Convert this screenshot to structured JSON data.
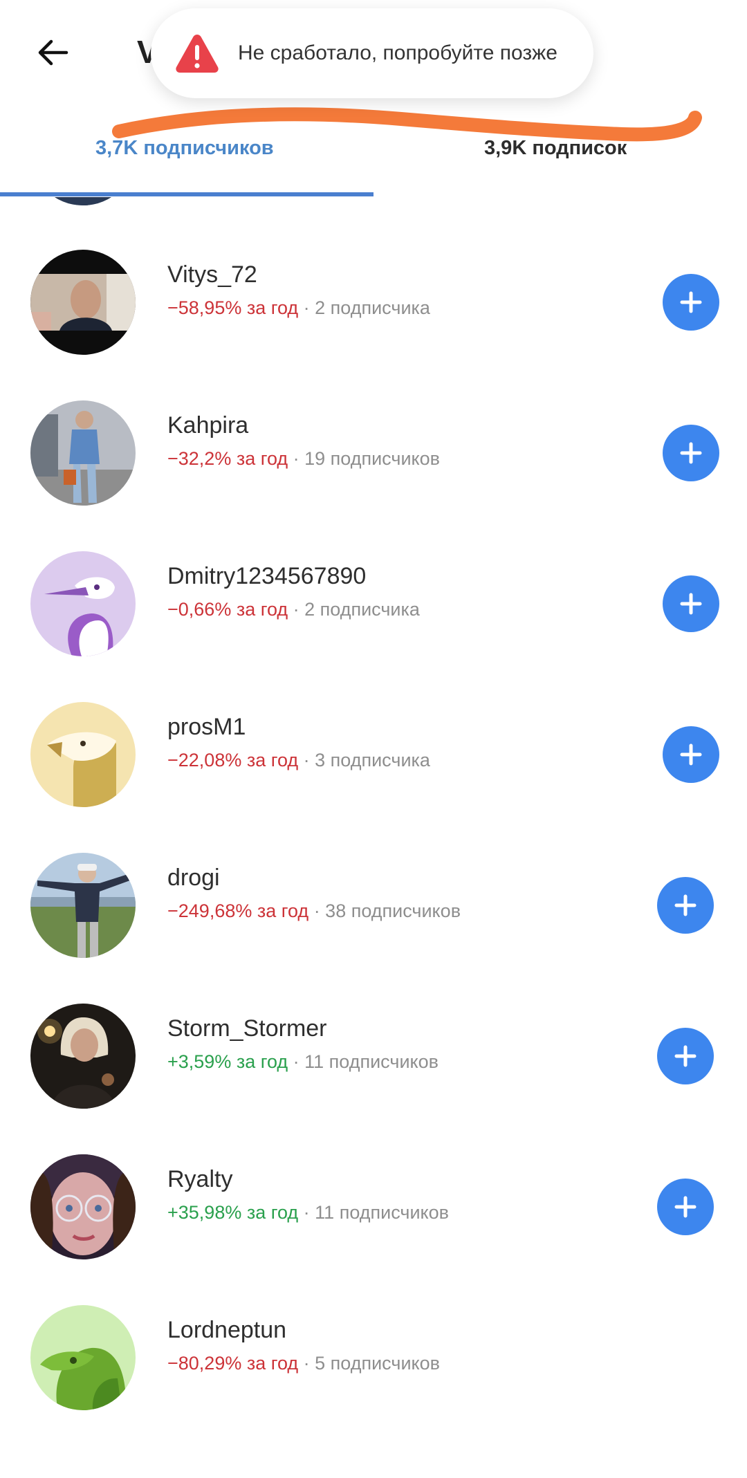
{
  "header": {
    "title_fragment": "V",
    "toast_text": "Не сработало, попробуйте позже"
  },
  "tabs": [
    {
      "label": "3,7K подписчиков"
    },
    {
      "label": "3,9K подписок"
    }
  ],
  "users": [
    {
      "name": "Vitys_72",
      "change": "−58,95% за год",
      "followers": " · 2 подписчика"
    },
    {
      "name": "Kahpira",
      "change": "−32,2% за год",
      "followers": " · 19 подписчиков"
    },
    {
      "name": "Dmitry1234567890",
      "change": "−0,66% за год",
      "followers": " · 2 подписчика"
    },
    {
      "name": "prosM1",
      "change": "−22,08% за год",
      "followers": " · 3 подписчика"
    },
    {
      "name": "drogi",
      "change": "−249,68% за год",
      "followers": " · 38 подписчиков"
    },
    {
      "name": "Storm_Stormer",
      "change": "+3,59% за год",
      "followers": " · 11 подписчиков"
    },
    {
      "name": "Ryalty",
      "change": "+35,98% за год",
      "followers": " · 11 подписчиков"
    },
    {
      "name": "Lordneptun",
      "change": "−80,29% за год",
      "followers": " · 5 подписчиков"
    }
  ],
  "colors": {
    "accent": "#3d86ee",
    "tab_active": "#4a86c8",
    "negative": "#cc3338",
    "positive": "#2aa04d",
    "scribble": "#f47a3a",
    "warning": "#e8424a"
  },
  "icons": {
    "back": "arrow-left-icon",
    "warning": "warning-icon",
    "add": "plus-icon"
  }
}
